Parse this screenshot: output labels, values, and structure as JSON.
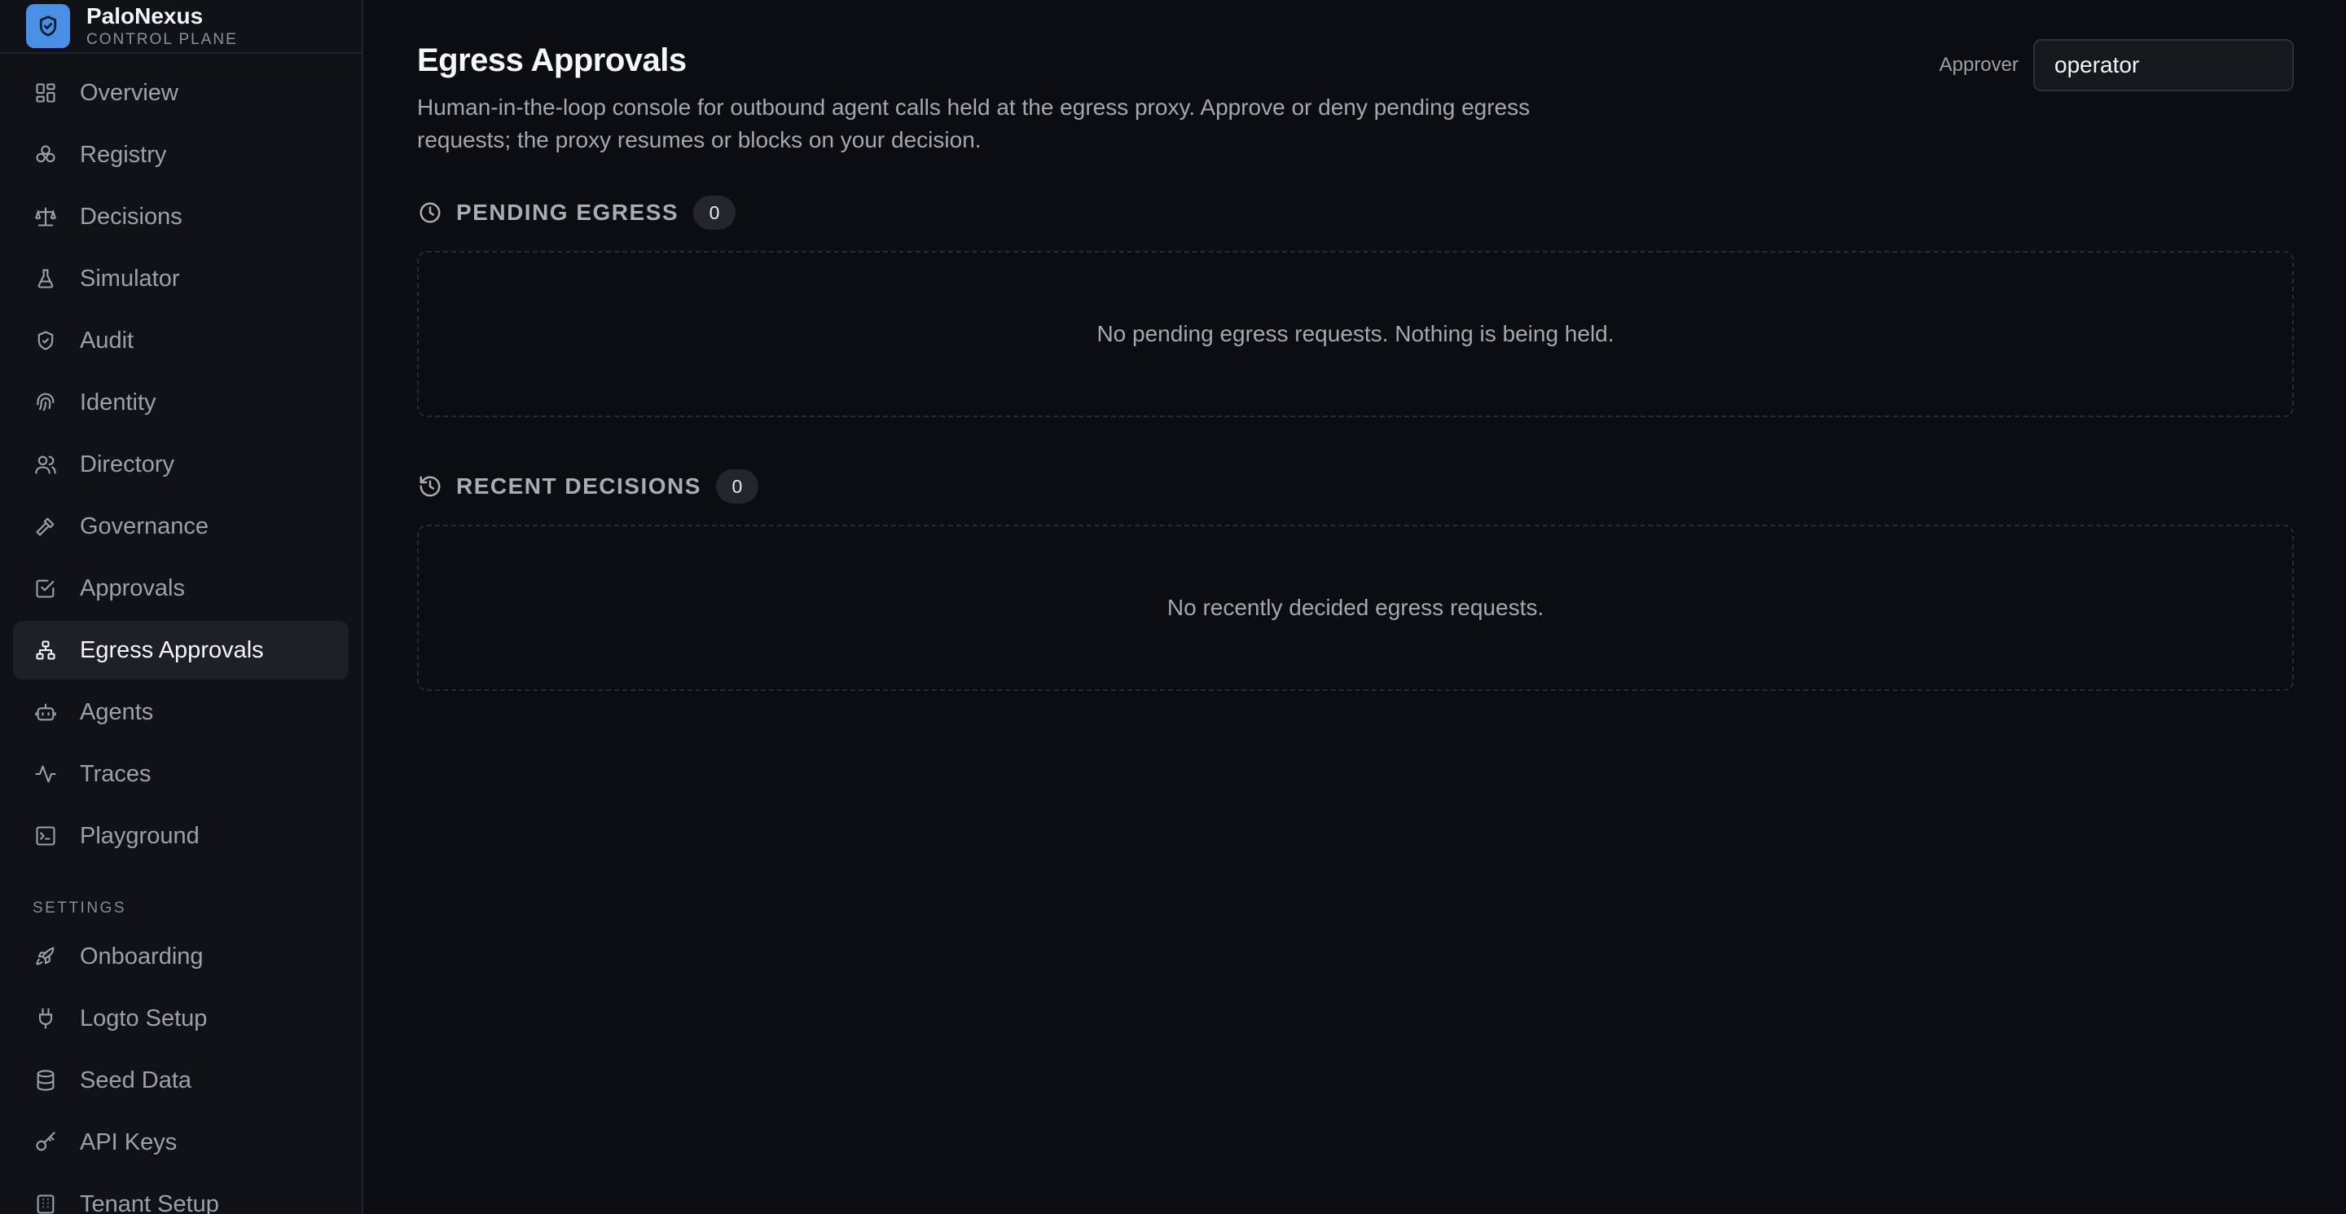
{
  "brand": {
    "name": "PaloNexus",
    "subtitle": "CONTROL PLANE",
    "accent": "#4a8fe6"
  },
  "nav": {
    "items": [
      {
        "label": "Overview",
        "icon": "grid-icon"
      },
      {
        "label": "Registry",
        "icon": "boxes-icon"
      },
      {
        "label": "Decisions",
        "icon": "scale-icon"
      },
      {
        "label": "Simulator",
        "icon": "flask-icon"
      },
      {
        "label": "Audit",
        "icon": "shield-check-icon"
      },
      {
        "label": "Identity",
        "icon": "fingerprint-icon"
      },
      {
        "label": "Directory",
        "icon": "users-icon"
      },
      {
        "label": "Governance",
        "icon": "gavel-icon"
      },
      {
        "label": "Approvals",
        "icon": "checkbox-icon"
      },
      {
        "label": "Egress Approvals",
        "icon": "network-icon",
        "active": true
      },
      {
        "label": "Agents",
        "icon": "bot-icon"
      },
      {
        "label": "Traces",
        "icon": "activity-icon"
      },
      {
        "label": "Playground",
        "icon": "terminal-icon"
      }
    ],
    "settings_label": "SETTINGS",
    "settings_items": [
      {
        "label": "Onboarding",
        "icon": "rocket-icon"
      },
      {
        "label": "Logto Setup",
        "icon": "plug-icon"
      },
      {
        "label": "Seed Data",
        "icon": "database-icon"
      },
      {
        "label": "API Keys",
        "icon": "key-icon"
      },
      {
        "label": "Tenant Setup",
        "icon": "building-icon"
      }
    ]
  },
  "page": {
    "title": "Egress Approvals",
    "description": "Human-in-the-loop console for outbound agent calls held at the egress proxy. Approve or deny pending egress requests; the proxy resumes or blocks on your decision.",
    "approver_label": "Approver",
    "approver_value": "operator"
  },
  "pending": {
    "title": "PENDING EGRESS",
    "count": "0",
    "empty_text": "No pending egress requests. Nothing is being held."
  },
  "recent": {
    "title": "RECENT DECISIONS",
    "count": "0",
    "empty_text": "No recently decided egress requests."
  }
}
